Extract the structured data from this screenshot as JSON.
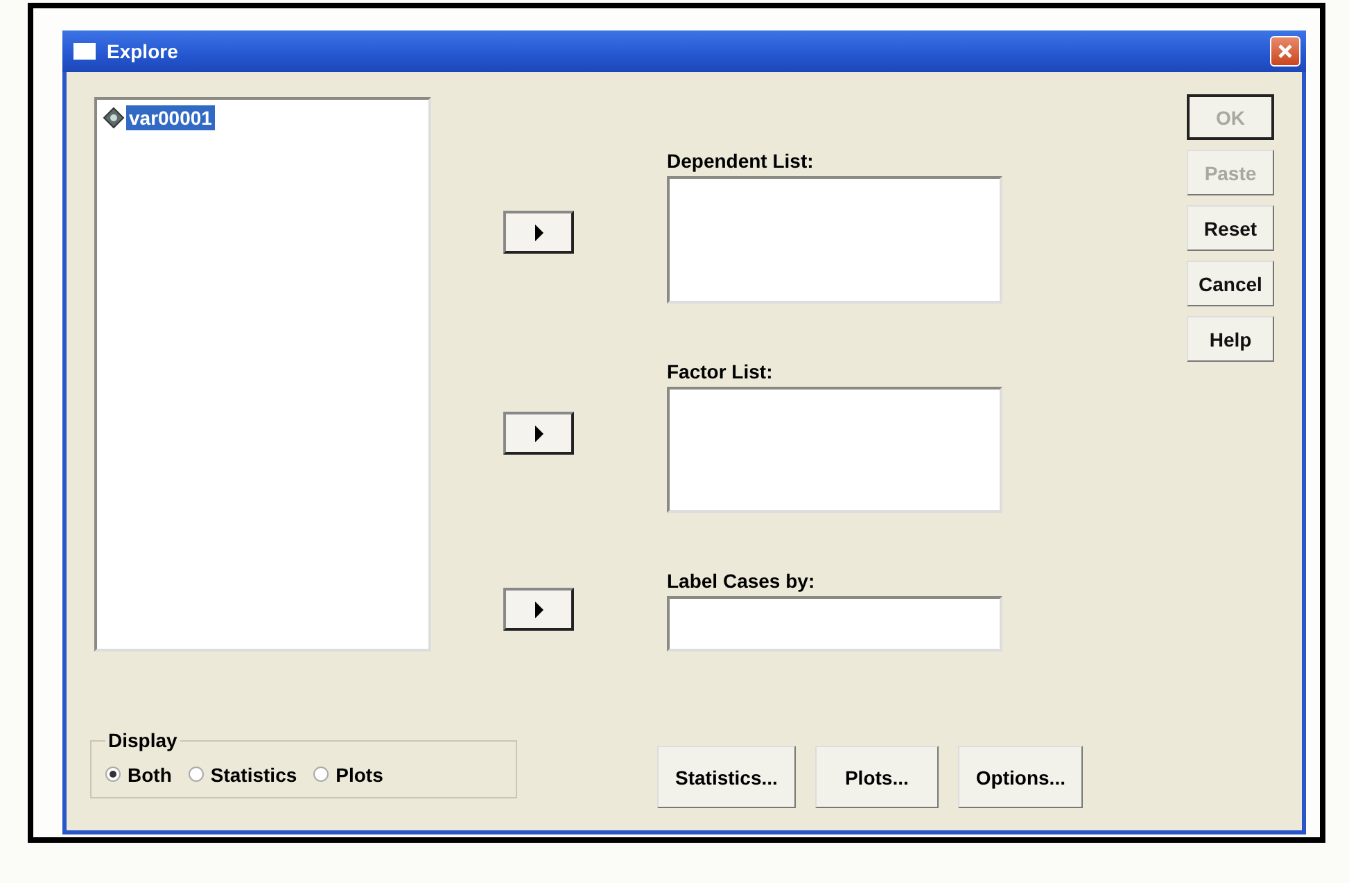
{
  "window": {
    "title": "Explore"
  },
  "variables": [
    {
      "name": "var00001",
      "selected": true
    }
  ],
  "targets": [
    {
      "label": "Dependent List:",
      "kind": "list"
    },
    {
      "label": "Factor List:",
      "kind": "list"
    },
    {
      "label": "Label Cases by:",
      "kind": "field"
    }
  ],
  "buttons": [
    {
      "label": "OK",
      "disabled": true,
      "default": true
    },
    {
      "label": "Paste",
      "disabled": true,
      "default": false
    },
    {
      "label": "Reset",
      "disabled": false,
      "default": false
    },
    {
      "label": "Cancel",
      "disabled": false,
      "default": false
    },
    {
      "label": "Help",
      "disabled": false,
      "default": false
    }
  ],
  "display": {
    "title": "Display",
    "options": [
      {
        "label": "Both",
        "selected": true
      },
      {
        "label": "Statistics",
        "selected": false
      },
      {
        "label": "Plots",
        "selected": false
      }
    ]
  },
  "bottom_buttons": [
    "Statistics...",
    "Plots...",
    "Options..."
  ]
}
